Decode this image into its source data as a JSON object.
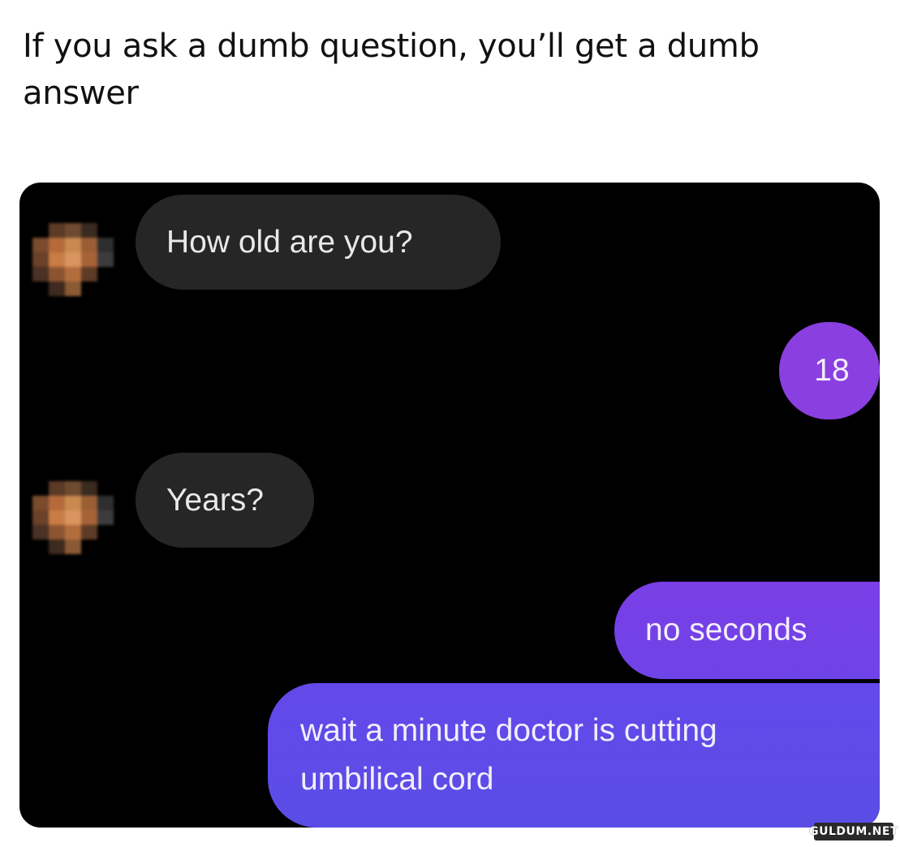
{
  "post": {
    "caption": "If you ask a dumb question, you’ll get a dumb answer"
  },
  "chat": {
    "messages": [
      {
        "sender": "other",
        "text": "How old are you?"
      },
      {
        "sender": "self",
        "text": "18"
      },
      {
        "sender": "other",
        "text": "Years?"
      },
      {
        "sender": "self",
        "text": "no seconds"
      },
      {
        "sender": "self",
        "text": "wait a minute doctor is cutting umbilical cord"
      }
    ]
  },
  "watermark": {
    "text": "GULDUM.NET"
  },
  "colors": {
    "background": "#ffffff",
    "chat_background": "#000000",
    "incoming_bubble": "#262626",
    "outgoing_bubble_purple": "#8a3fe0",
    "outgoing_bubble_indigo": "#5a4de6"
  }
}
